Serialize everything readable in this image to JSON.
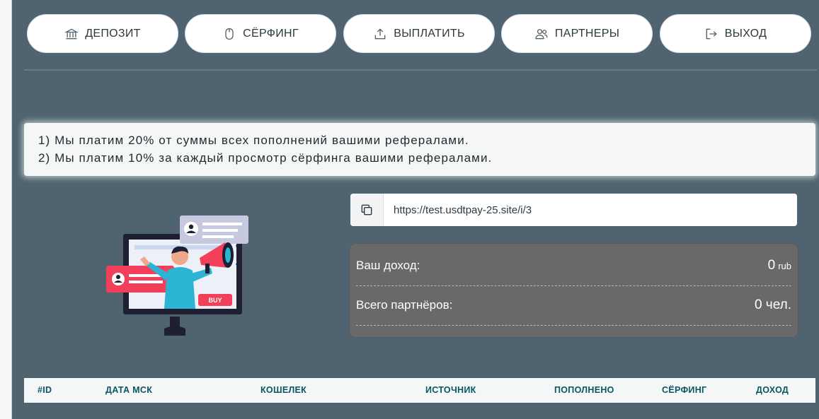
{
  "nav": {
    "deposit": {
      "label": "ДЕПОЗИТ",
      "icon": "bank-icon"
    },
    "surfing": {
      "label": "СЁРФИНГ",
      "icon": "mouse-icon"
    },
    "payout": {
      "label": "ВЫПЛАТИТЬ",
      "icon": "upload-icon"
    },
    "partners": {
      "label": "ПАРТНЕРЫ",
      "icon": "users-icon"
    },
    "logout": {
      "label": "ВЫХОД",
      "icon": "logout-icon"
    }
  },
  "notice": {
    "line1": "1) Мы платим 20% от суммы всех пополнений вашими рефералами.",
    "line2": "2) Мы платим 10% за каждый просмотр сёрфинга вашими рефералами."
  },
  "illustration": {
    "badge_text": "BUY"
  },
  "referral": {
    "link": "https://test.usdtpay-25.site/i/3",
    "copy_icon": "copy-icon"
  },
  "stats": {
    "income_label": "Ваш доход:",
    "income_value": "0",
    "income_unit": "rub",
    "partners_label": "Всего партнёров:",
    "partners_value": "0 чел."
  },
  "table": {
    "columns": [
      "#ID",
      "ДАТА МСК",
      "КОШЕЛЕК",
      "ИСТОЧНИК",
      "ПОПОЛНЕНО",
      "СЁРФИНГ",
      "ДОХОД"
    ]
  },
  "colors": {
    "background": "#4f6470",
    "stats_panel": "#696969",
    "header_text": "#0b5560"
  }
}
